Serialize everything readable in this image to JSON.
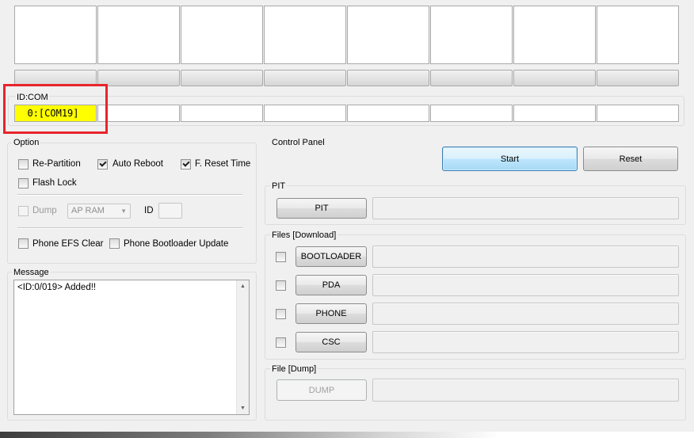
{
  "port_area": {
    "id_com_label": "ID:COM",
    "active_port": "0:[COM19]",
    "cell_count": 8
  },
  "option": {
    "title": "Option",
    "re_partition": {
      "label": "Re-Partition",
      "checked": false
    },
    "auto_reboot": {
      "label": "Auto Reboot",
      "checked": true
    },
    "f_reset_time": {
      "label": "F. Reset Time",
      "checked": true
    },
    "flash_lock": {
      "label": "Flash Lock",
      "checked": false
    },
    "dump": {
      "label": "Dump",
      "checked": false,
      "enabled": false
    },
    "dump_target": "AP RAM",
    "id_label": "ID",
    "phone_efs_clear": {
      "label": "Phone EFS Clear",
      "checked": false
    },
    "phone_bootloader_update": {
      "label": "Phone Bootloader Update",
      "checked": false
    }
  },
  "message": {
    "title": "Message",
    "text": "<ID:0/019> Added!!"
  },
  "control_panel": {
    "title": "Control Panel",
    "start_label": "Start",
    "reset_label": "Reset"
  },
  "pit": {
    "title": "PIT",
    "button_label": "PIT"
  },
  "files": {
    "title": "Files [Download]",
    "items": [
      {
        "label": "BOOTLOADER",
        "checked": false
      },
      {
        "label": "PDA",
        "checked": false
      },
      {
        "label": "PHONE",
        "checked": false
      },
      {
        "label": "CSC",
        "checked": false
      }
    ]
  },
  "file_dump": {
    "title": "File [Dump]",
    "button_label": "DUMP"
  },
  "colors": {
    "active_port_bg": "#ffff00",
    "highlight_border": "#e8242c",
    "focus_button": "#3c7fb1"
  }
}
